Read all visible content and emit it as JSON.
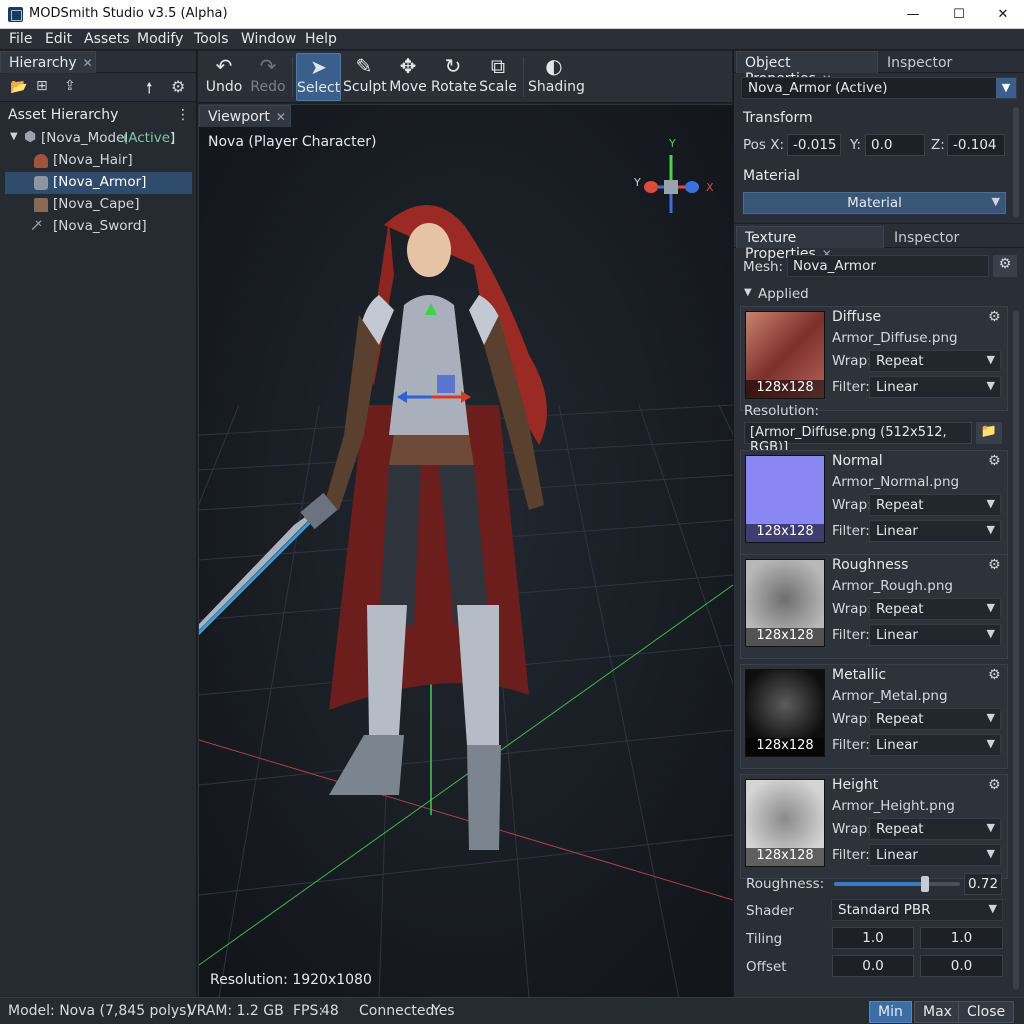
{
  "window": {
    "title": "MODSmith Studio v3.5 (Alpha)",
    "minimize": "—",
    "maximize": "☐",
    "close": "✕"
  },
  "menu": [
    "File",
    "Edit",
    "Assets",
    "Modify",
    "Tools",
    "Window",
    "Help"
  ],
  "hierarchy": {
    "tab": "Hierarchy",
    "header": "Asset Hierarchy",
    "root": {
      "label": "[Nova_Model",
      "status": "(Active)",
      "close": "]"
    },
    "items": [
      {
        "label": "[Nova_Hair]",
        "icon": "hair-icon",
        "color": "#a0533a"
      },
      {
        "label": "[Nova_Armor]",
        "icon": "armor-icon",
        "color": "#8e96a3"
      },
      {
        "label": "[Nova_Cape]",
        "icon": "cape-icon",
        "color": "#8a6a52"
      },
      {
        "label": "[Nova_Sword]",
        "icon": "sword-icon",
        "color": "#9aa3ad"
      }
    ]
  },
  "toolbar": {
    "undo": "Undo",
    "redo": "Redo",
    "select": "Select",
    "sculpt": "Sculpt",
    "move": "Move",
    "rotate": "Rotate",
    "scale": "Scale",
    "shading": "Shading"
  },
  "viewport": {
    "tab": "Viewport",
    "caption": "Nova (Player Character)",
    "resolution": "Resolution: 1920x1080",
    "gizmo": {
      "x": "X",
      "y": "Y",
      "z": "Y"
    }
  },
  "object_properties": {
    "tab": "Object Properties",
    "tab2": "Inspector",
    "object": "Nova_Armor (Active)",
    "transform_label": "Transform",
    "pos_x_label": "Pos X:",
    "pos_x": "-0.015",
    "y_label": "Y:",
    "y": "0.0",
    "z_label": "Z:",
    "z": "-0.104",
    "material_label": "Material",
    "material_value": "Material"
  },
  "texture_properties": {
    "tab": "Texture Properties",
    "tab2": "Inspector",
    "mesh_label": "Mesh:",
    "mesh": "Nova_Armor",
    "applied": "Applied",
    "resolution_label": "Resolution:",
    "resolution_value": "[Armor_Diffuse.png (512x512, RGB)]",
    "textures": [
      {
        "name": "Diffuse",
        "file": "Armor_Diffuse.png",
        "wrap": "Repeat",
        "filter": "Linear",
        "size": "128x128",
        "color": "#8a3f36"
      },
      {
        "name": "Normal",
        "file": "Armor_Normal.png",
        "wrap": "Repeat",
        "filter": "Linear",
        "size": "128x128",
        "color": "#8b87f2"
      },
      {
        "name": "Roughness",
        "file": "Armor_Rough.png",
        "wrap": "Repeat",
        "filter": "Linear",
        "size": "128x128",
        "color": "#9c9c9c"
      },
      {
        "name": "Metallic",
        "file": "Armor_Metal.png",
        "wrap": "Repeat",
        "filter": "Linear",
        "size": "128x128",
        "color": "#1a1a1a"
      },
      {
        "name": "Height",
        "file": "Armor_Height.png",
        "wrap": "Repeat",
        "filter": "Linear",
        "size": "128x128",
        "color": "#bcbcbc"
      }
    ],
    "wrap_label": "Wrap:",
    "filter_label": "Filter:",
    "roughness_label": "Roughness:",
    "roughness_value": "0.72",
    "roughness_fraction": 0.72,
    "shader_label": "Shader",
    "shader": "Standard PBR",
    "tiling_label": "Tiling",
    "tiling": [
      "1.0",
      "1.0"
    ],
    "offset_label": "Offset",
    "offset": [
      "0.0",
      "0.0"
    ]
  },
  "status": {
    "model": "Model: Nova (7,845 polys)",
    "vram": "VRAM: 1.2 GB",
    "fps_label": "FPS:",
    "fps": "48",
    "connected_label": "Connected:",
    "connected": "Yes",
    "min": "Min",
    "max": "Max",
    "close": "Close"
  }
}
